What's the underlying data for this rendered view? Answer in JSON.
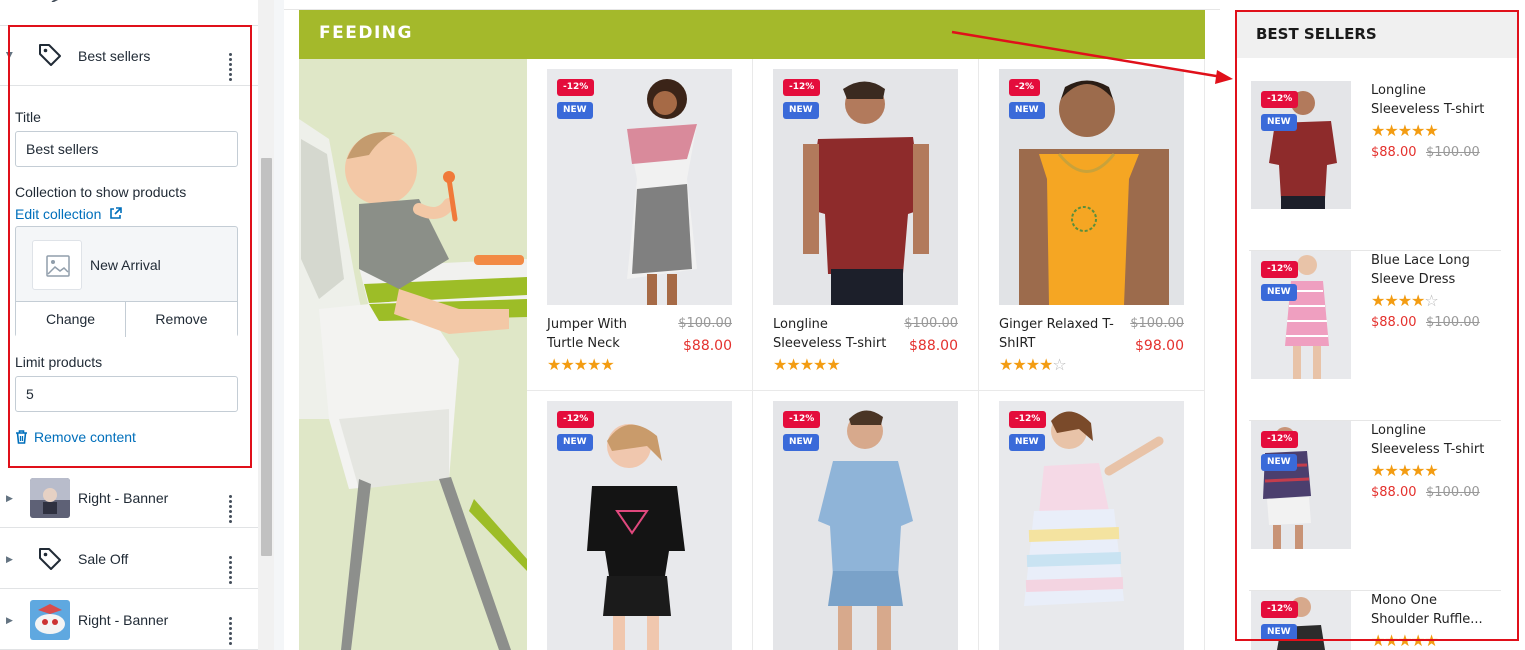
{
  "editor": {
    "sections": [
      {
        "label": "Best sellers",
        "icon": "tag-icon",
        "expanded": true
      },
      {
        "label": "Right - Banner",
        "icon": "image-thumbnail"
      },
      {
        "label": "Sale Off",
        "icon": "tag-icon"
      },
      {
        "label": "Right - Banner",
        "icon": "image-thumbnail"
      }
    ],
    "title_label": "Title",
    "title_value": "Best sellers",
    "collection_label": "Collection to show products",
    "edit_collection": "Edit collection",
    "collection_name": "New Arrival",
    "change_label": "Change",
    "remove_label": "Remove",
    "limit_label": "Limit products",
    "limit_value": "5",
    "remove_content": "Remove content"
  },
  "feeding": {
    "title": "FEEDING",
    "color": "#a4b92b"
  },
  "products": [
    {
      "name": "Jumper With Turtle Neck",
      "old_price": "$100.00",
      "price": "$88.00",
      "sale": "-12%",
      "new": "NEW",
      "rating": 5
    },
    {
      "name": "Longline Sleeveless T-shirt",
      "old_price": "$100.00",
      "price": "$88.00",
      "sale": "-12%",
      "new": "NEW",
      "rating": 5
    },
    {
      "name": "Ginger Relaxed T-ShIRT",
      "old_price": "$100.00",
      "price": "$98.00",
      "sale": "-2%",
      "new": "NEW",
      "rating": 4
    },
    {
      "sale": "-12%",
      "new": "NEW"
    },
    {
      "sale": "-12%",
      "new": "NEW"
    },
    {
      "sale": "-12%",
      "new": "NEW"
    }
  ],
  "best_sellers": {
    "title": "BEST SELLERS",
    "items": [
      {
        "name": "Longline Sleeveless T-shirt",
        "price": "$88.00",
        "old_price": "$100.00",
        "sale": "-12%",
        "new": "NEW",
        "rating": 5
      },
      {
        "name": "Blue Lace Long Sleeve Dress",
        "price": "$88.00",
        "old_price": "$100.00",
        "sale": "-12%",
        "new": "NEW",
        "rating": 4
      },
      {
        "name": "Longline Sleeveless T-shirt",
        "price": "$88.00",
        "old_price": "$100.00",
        "sale": "-12%",
        "new": "NEW",
        "rating": 5
      },
      {
        "name": "Mono One Shoulder Ruffle...",
        "sale": "-12%",
        "new": "NEW",
        "rating": 5
      }
    ]
  },
  "colors": {
    "highlight": "#e0101a",
    "sale_badge": "#e40d3c",
    "new_badge": "#3a6ad9",
    "price": "#e4312d",
    "star": "#f39c12",
    "link": "#006fbb"
  }
}
